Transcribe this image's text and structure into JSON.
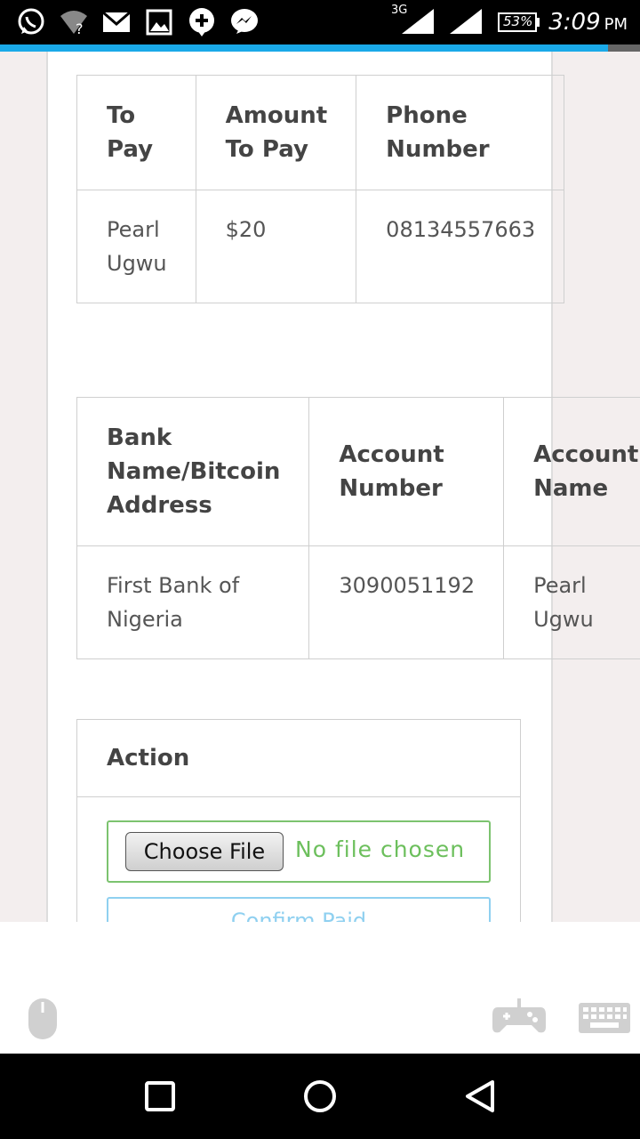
{
  "status_bar": {
    "network": "3G",
    "battery": "53%",
    "time": "3:09",
    "ampm": "PM",
    "icons": [
      "whatsapp-icon",
      "wifi-icon",
      "mail-icon",
      "image-icon",
      "plus-chat-icon",
      "messenger-icon",
      "signal-icon",
      "signal-icon",
      "battery-icon"
    ]
  },
  "page_progress": 0.95,
  "payee_table": {
    "headers": [
      "To Pay",
      "Amount To Pay",
      "Phone Number"
    ],
    "row": [
      "Pearl Ugwu",
      "$20",
      "08134557663"
    ]
  },
  "bank_table": {
    "headers": [
      "Bank Name/Bitcoin Address",
      "Account Number",
      "Account Name"
    ],
    "row": [
      "First Bank of Nigeria",
      "3090051192",
      "Pearl Ugwu"
    ]
  },
  "action": {
    "header": "Action",
    "choose_file_label": "Choose File",
    "file_status": "No file chosen",
    "confirm_label": "Confirm Paid"
  },
  "toolbar_icons": [
    "mouse-icon",
    "gamepad-icon",
    "keyboard-icon"
  ],
  "nav_icons": [
    "recent-apps-icon",
    "home-icon",
    "back-icon"
  ],
  "colors": {
    "progress": "#1aa9e8",
    "file_border": "#7cc36f",
    "confirm": "#8fd0f0"
  }
}
